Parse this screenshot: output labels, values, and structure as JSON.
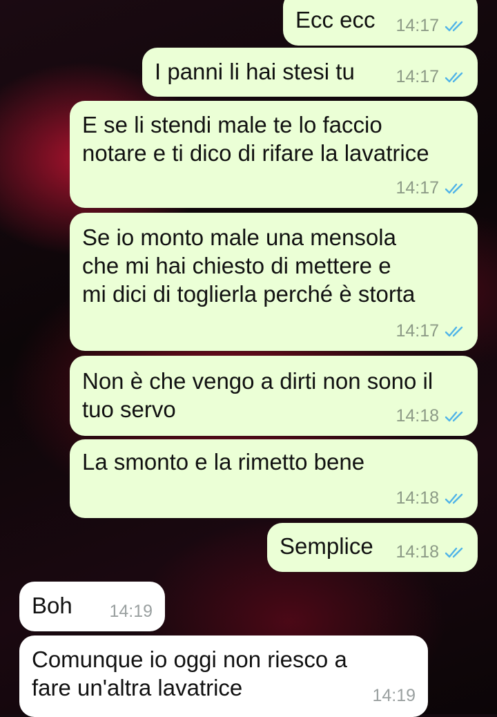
{
  "chat": {
    "messages": [
      {
        "direction": "out",
        "text": "Ecc ecc",
        "time": "14:17",
        "status_icon": "double-check-read-icon"
      },
      {
        "direction": "out",
        "text": "I panni li hai stesi tu",
        "time": "14:17",
        "status_icon": "double-check-read-icon"
      },
      {
        "direction": "out",
        "text": "E se li stendi male te lo faccio\nnotare e ti dico di rifare la lavatrice",
        "time": "14:17",
        "status_icon": "double-check-read-icon"
      },
      {
        "direction": "out",
        "text": "Se io monto male una mensola\nche mi hai chiesto di mettere e\nmi dici di toglierla perché è storta",
        "time": "14:17",
        "status_icon": "double-check-read-icon"
      },
      {
        "direction": "out",
        "text": "Non è che vengo a dirti non sono il\ntuo servo",
        "time": "14:18",
        "status_icon": "double-check-read-icon"
      },
      {
        "direction": "out",
        "text": "La smonto e la rimetto bene",
        "time": "14:18",
        "status_icon": "double-check-read-icon"
      },
      {
        "direction": "out",
        "text": "Semplice",
        "time": "14:18",
        "status_icon": "double-check-read-icon"
      },
      {
        "direction": "in",
        "text": "Boh",
        "time": "14:19"
      },
      {
        "direction": "in",
        "text": "Comunque io oggi non riesco a\nfare un'altra lavatrice",
        "time": "14:19"
      }
    ]
  },
  "colors": {
    "outgoing_bubble": "#ebffd6",
    "incoming_bubble": "#ffffff",
    "read_ticks": "#4fb3e8"
  }
}
